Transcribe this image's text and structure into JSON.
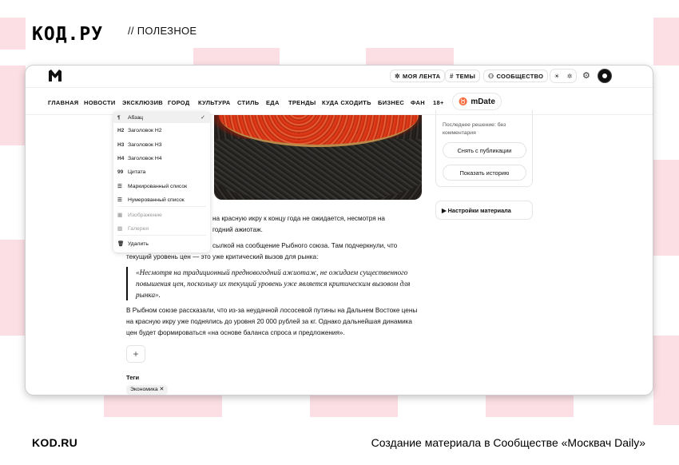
{
  "header": {
    "logo": "КОД.РУ",
    "rubric": "// ПОЛЕЗНОЕ"
  },
  "footer": {
    "brand": "KOD.RU",
    "caption": "Создание материала в Сообществе «Москвач Daily»"
  },
  "topbar": {
    "logo_letter": "M",
    "my_feed": "МОЯ ЛЕНТА",
    "topics": "ТЕМЫ",
    "community": "СООБЩЕСТВО",
    "icons": {
      "feed": "sparkle-icon",
      "topics": "hash-icon",
      "community": "people-icon",
      "theme": "sun-icon",
      "settings": "gear-icon",
      "avatar": "avatar-icon"
    }
  },
  "nav": {
    "items": [
      "ГЛАВНАЯ",
      "НОВОСТИ",
      "ЭКСКЛЮЗИВ",
      "ГОРОД",
      "КУЛЬТУРА",
      "СТИЛЬ",
      "ЕДА",
      "ТРЕНДЫ",
      "КУДА СХОДИТЬ",
      "БИЗНЕС",
      "ФАН",
      "18+"
    ],
    "mdate": "mDate"
  },
  "menu": {
    "items": [
      {
        "icon": "¶",
        "label": "Абзац",
        "selected": true
      },
      {
        "icon": "H2",
        "label": "Заголовок H2"
      },
      {
        "icon": "H3",
        "label": "Заголовок H3"
      },
      {
        "icon": "H4",
        "label": "Заголовок H4"
      },
      {
        "icon": "99",
        "label": "Цитата"
      },
      {
        "icon": "☰",
        "label": "Маркированный список"
      },
      {
        "icon": "☰",
        "label": "Нумерованный список"
      },
      {
        "icon": "▣",
        "label": "Изображение",
        "disabled": true
      },
      {
        "icon": "▥",
        "label": "Галерея",
        "disabled": true
      },
      {
        "icon": "🗑",
        "label": "Удалить"
      }
    ]
  },
  "article": {
    "p1_line1": "на красную икру к концу года не ожидается, несмотря на",
    "p1_line2": "годний ажиотаж.",
    "p2_line1": "сылкой на сообщение Рыбного союза. Там подчеркнули, что",
    "p2_line2": "текущий уровень цен — это уже критический вызов для рынка:",
    "quote": "«Несмотря на традиционный предновогодний ажиотаж, не ожидаем существенного повышения цен, поскольку их текущий уровень уже является критическим вызовом для рынка».",
    "p3": "В Рыбном союзе рассказали, что из-за неудачной лососевой путины на Дальнем Востоке цены на красную икру уже поднялись до уровня 20 000 рублей за кг. Однако дальнейшая динамика цен будет формироваться «на основе баланса спроса и предложения».",
    "add": "+",
    "tags_label": "Теги",
    "tag": "Экономика ✕"
  },
  "panel": {
    "last_decision": "Последнее решение: без комментария",
    "unpublish": "Снять с публикации",
    "history": "Показать историю",
    "settings": "▶ Настройки материала"
  }
}
